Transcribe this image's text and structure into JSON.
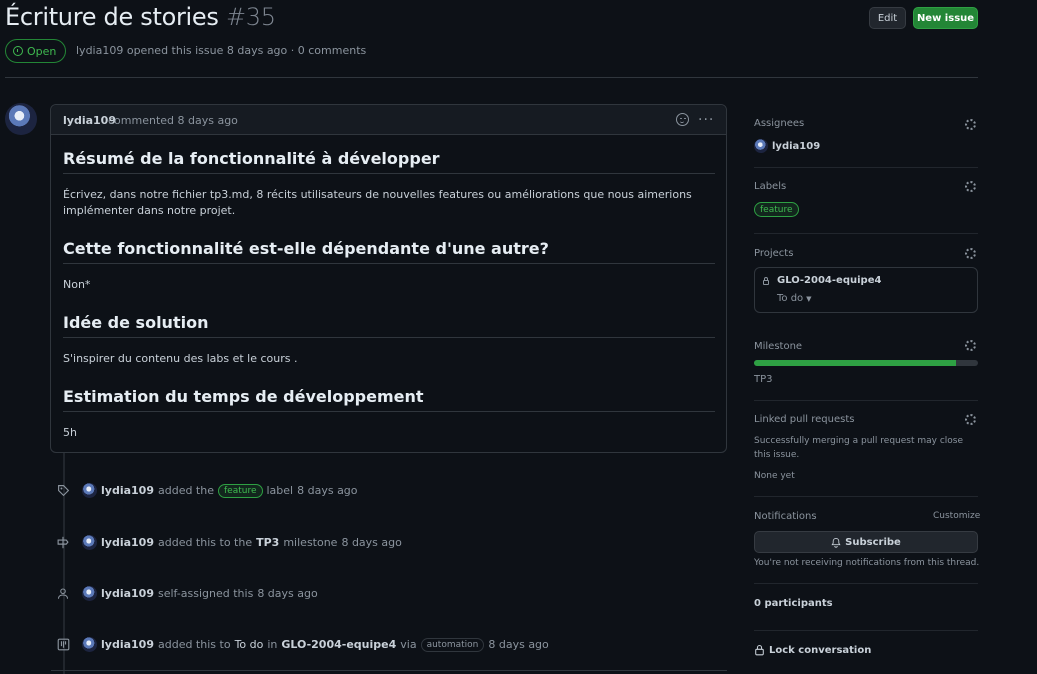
{
  "issue": {
    "title": "Écriture de stories",
    "number": "#35",
    "state": "Open",
    "author": "lydia109",
    "meta_text": "opened this issue 8 days ago · 0 comments"
  },
  "header": {
    "edit_label": "Edit",
    "new_issue_label": "New issue"
  },
  "comment": {
    "author": "lydia109",
    "date": "commented 8 days ago",
    "sections": [
      {
        "heading": "Résumé de la fonctionnalité à développer",
        "body": "Écrivez, dans notre fichier tp3.md, 8 récits utilisateurs de nouvelles features ou améliorations que nous aimerions implémenter dans notre projet."
      },
      {
        "heading": "Cette fonctionnalité est-elle dépendante d'une autre?",
        "body": "Non*"
      },
      {
        "heading": "Idée de solution",
        "body": "S'inspirer du contenu des labs et le cours ."
      },
      {
        "heading": "Estimation du temps de développement",
        "body": "5h"
      }
    ]
  },
  "timeline": [
    {
      "author": "lydia109",
      "pre": "added the",
      "label": "feature",
      "post": "label",
      "time": "8 days ago"
    },
    {
      "author": "lydia109",
      "pre": "added this to the",
      "milestone": "TP3",
      "post": "milestone",
      "time": "8 days ago"
    },
    {
      "author": "lydia109",
      "pre": "self-assigned this",
      "time": "8 days ago"
    },
    {
      "author": "lydia109",
      "pre": "added this to",
      "column": "To do",
      "mid": "in",
      "project": "GLO-2004-equipe4",
      "via": "via",
      "badge": "automation",
      "time": "8 days ago"
    }
  ],
  "sidebar": {
    "assignees": {
      "title": "Assignees",
      "value": "lydia109"
    },
    "labels": {
      "title": "Labels",
      "value": "feature"
    },
    "projects": {
      "title": "Projects",
      "name": "GLO-2004-equipe4",
      "status": "To do"
    },
    "milestone": {
      "title": "Milestone",
      "name": "TP3",
      "progress_percent": 90
    },
    "linked_prs": {
      "title": "Linked pull requests",
      "desc": "Successfully merging a pull request may close this issue.",
      "value": "None yet"
    },
    "notifications": {
      "title": "Notifications",
      "customize": "Customize",
      "subscribe": "Subscribe",
      "note": "You're not receiving notifications from this thread."
    },
    "participants": "0 participants",
    "lock": "Lock conversation"
  },
  "colors": {
    "accent_green": "#238636",
    "bg": "#0d1117",
    "border": "#30363d"
  }
}
